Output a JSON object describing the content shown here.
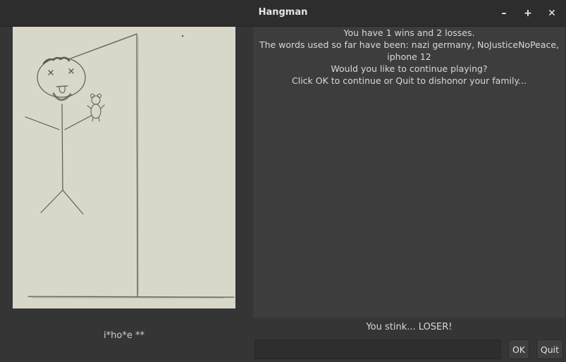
{
  "window": {
    "title": "Hangman",
    "controls": {
      "minimize_icon": "minimize-icon",
      "maximize_icon": "maximize-icon",
      "close_icon": "close-icon",
      "minimize_glyph": "–",
      "maximize_glyph": "+",
      "close_glyph": "✕"
    }
  },
  "game": {
    "word_display": "i*ho*e **",
    "messages": [
      "You have 1 wins and 2 losses.",
      "The words used so far have been: nazi germany, NoJusticeNoPeace,",
      "iphone 12",
      "Would you like to continue playing?",
      "Click OK to continue or Quit to dishonor your family..."
    ],
    "status": "You stink... LOSER!",
    "input_value": "",
    "input_placeholder": "",
    "ok_label": "OK",
    "quit_label": "Quit"
  },
  "colors": {
    "paper": "#d9d7c9",
    "pencil": "#5a5a52",
    "background": "#353535",
    "message_area": "#3d3d3d"
  }
}
